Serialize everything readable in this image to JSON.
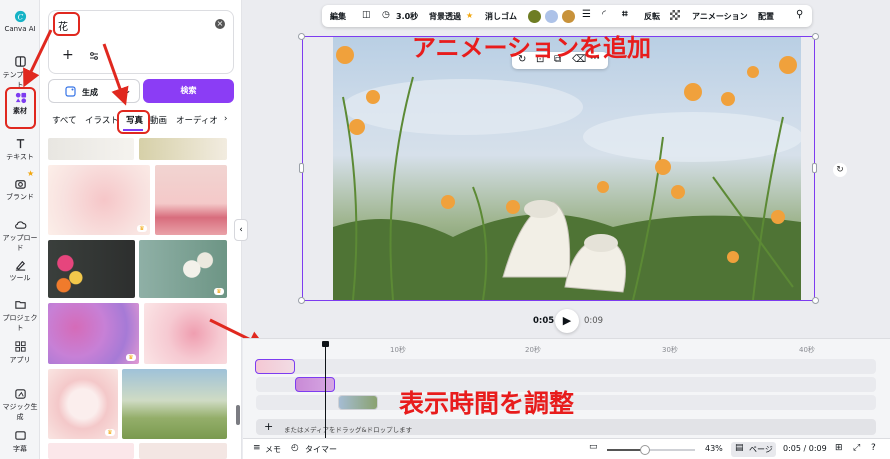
{
  "rail": {
    "items": [
      {
        "label": "Canva AI"
      },
      {
        "label": "テンプレート"
      },
      {
        "label": "素材"
      },
      {
        "label": "テキスト"
      },
      {
        "label": "ブランド"
      },
      {
        "label": "アップロード"
      },
      {
        "label": "ツール"
      },
      {
        "label": "プロジェクト"
      },
      {
        "label": "アプリ"
      },
      {
        "label": "マジック生成"
      },
      {
        "label": "字幕"
      }
    ]
  },
  "search": {
    "value": "花"
  },
  "panel": {
    "generate_label": "生成",
    "search_label": "検索",
    "tabs": [
      "すべて",
      "イラスト",
      "写真",
      "動画",
      "オーディオ"
    ]
  },
  "toolbar": {
    "edit": "編集",
    "duration": "3.0秒",
    "bg_remove": "背景透過",
    "eraser": "消しゴム",
    "flip": "反転",
    "animation": "アニメーション",
    "arrange": "配置",
    "colors": [
      "#6e7d23",
      "#adc2e8",
      "#c8923a"
    ]
  },
  "annotations": {
    "add_animation": "アニメーションを追加",
    "adjust_duration": "表示時間を調整"
  },
  "playback": {
    "current": "0:05",
    "total": "0:09"
  },
  "timeline": {
    "ticks": [
      "10秒",
      "20秒",
      "30秒",
      "40秒"
    ],
    "drop_hint": "またはメディアをドラッグ&ドロップします"
  },
  "footer": {
    "memo": "メモ",
    "timer": "タイマー",
    "zoom": "43%",
    "zoom_level": 0.43,
    "page_label": "ページ",
    "time": "0:05 / 0:09"
  }
}
